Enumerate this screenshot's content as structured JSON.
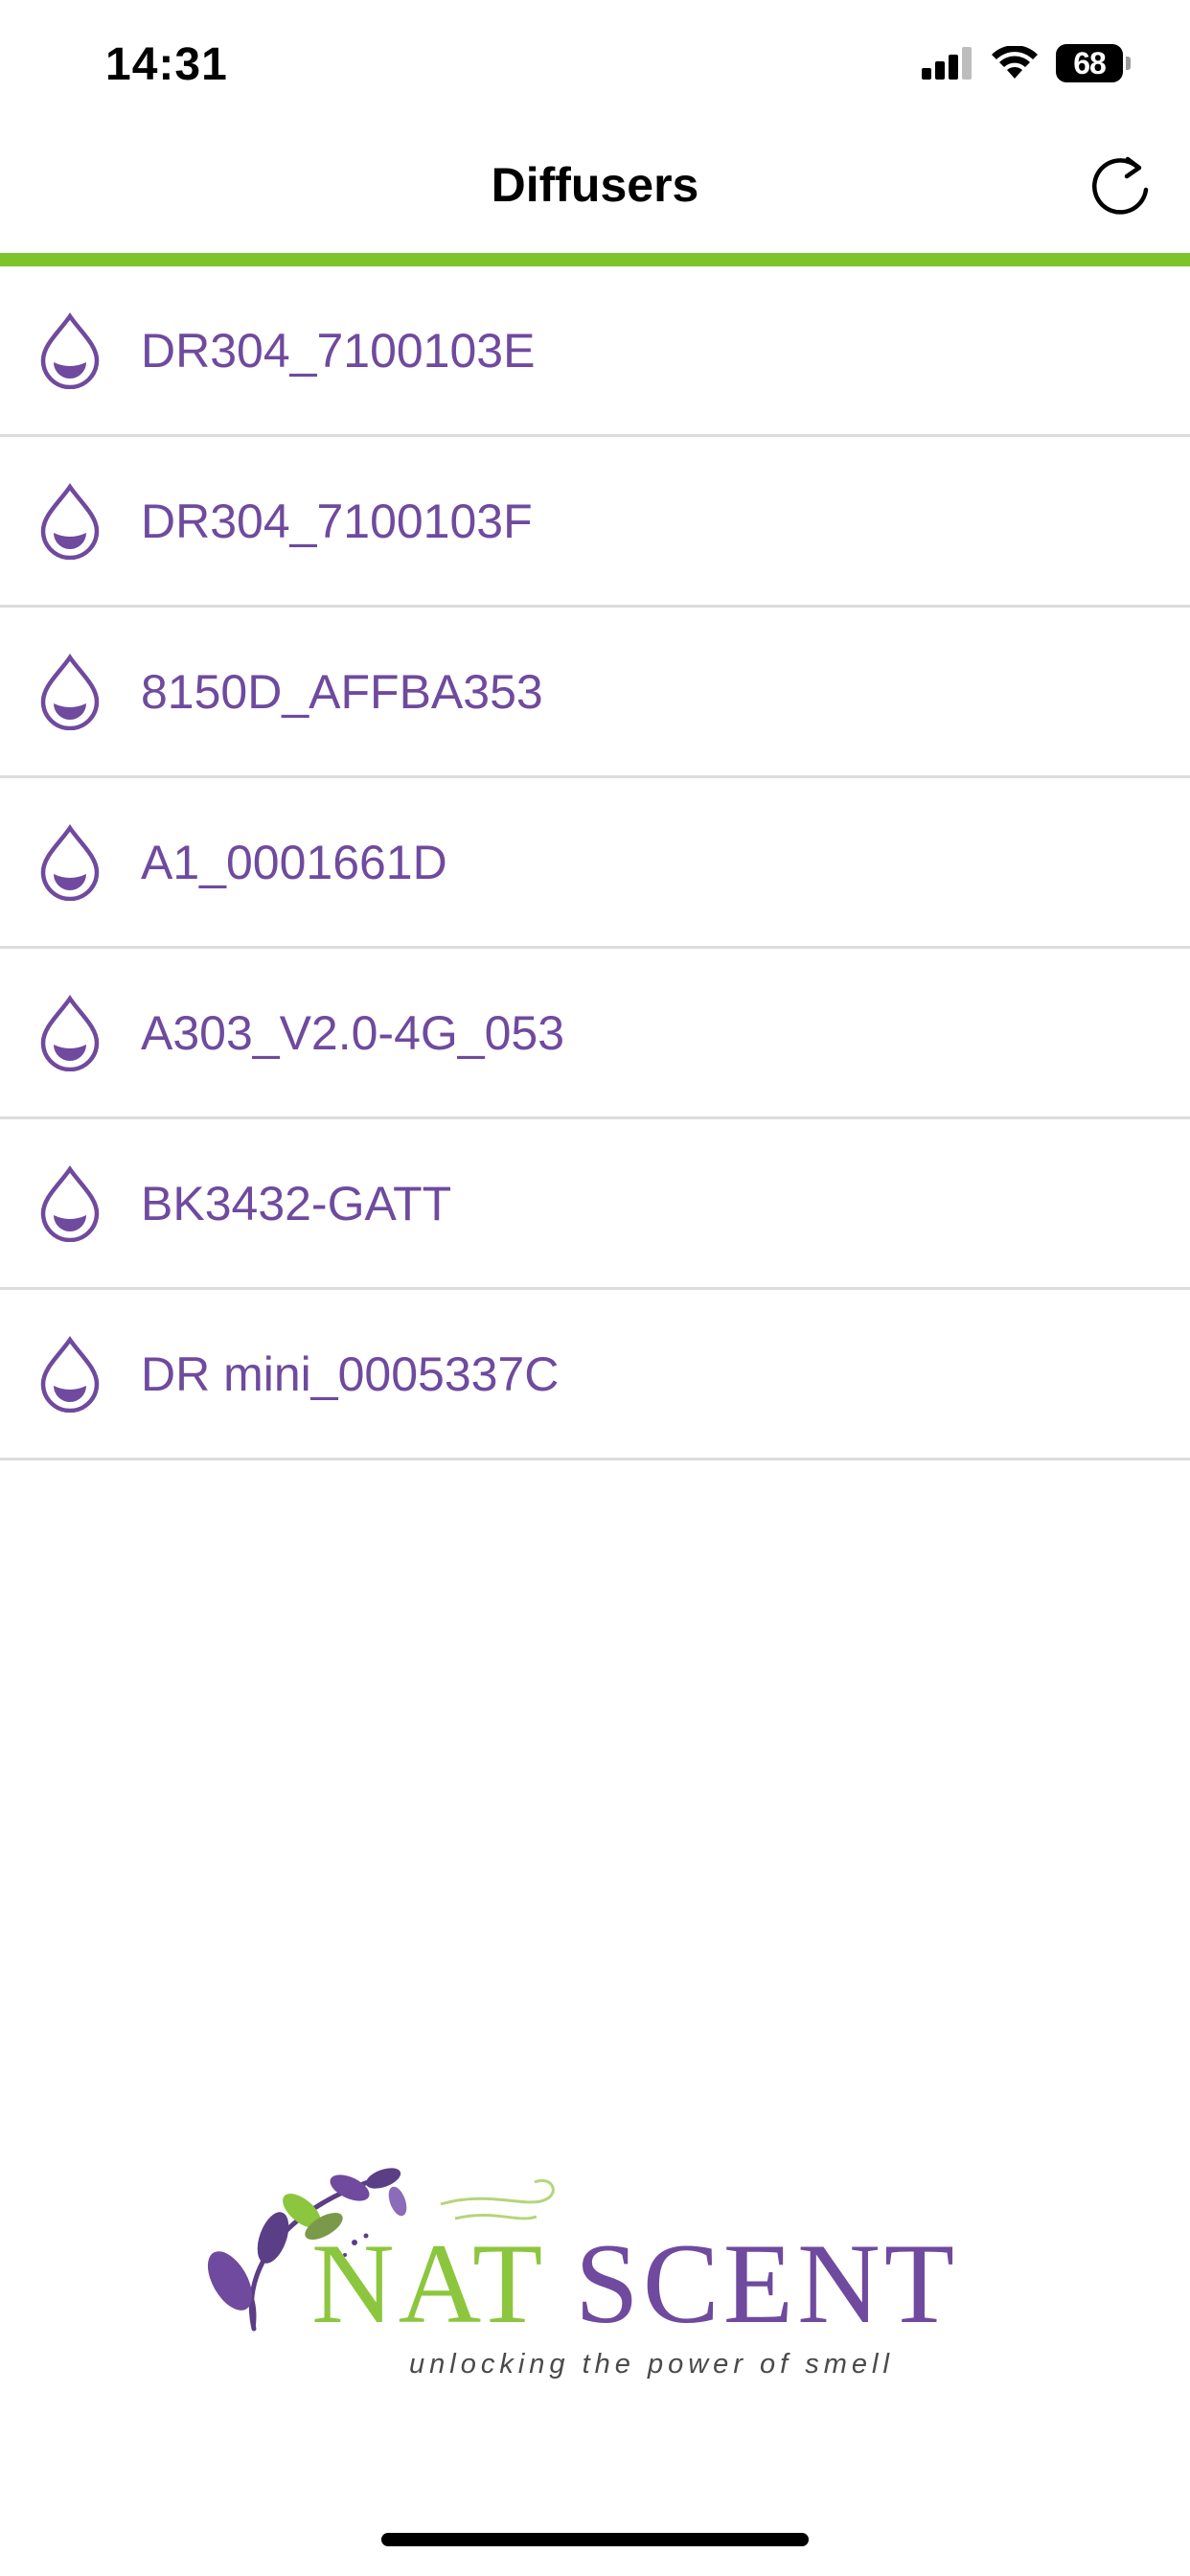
{
  "status_bar": {
    "time": "14:31",
    "battery_level": "68",
    "icons": [
      "signal-icon",
      "wifi-icon",
      "battery-icon"
    ]
  },
  "nav": {
    "title": "Diffusers",
    "refresh_icon": "refresh-icon"
  },
  "colors": {
    "accent_green": "#7dc42a",
    "device_purple": "#6f4a9e",
    "divider": "#dcdcdc"
  },
  "devices": [
    {
      "name": "DR304_7100103E",
      "icon": "droplet-icon"
    },
    {
      "name": "DR304_7100103F",
      "icon": "droplet-icon"
    },
    {
      "name": "8150D_AFFBA353",
      "icon": "droplet-icon"
    },
    {
      "name": "A1_0001661D",
      "icon": "droplet-icon"
    },
    {
      "name": "A303_V2.0-4G_053",
      "icon": "droplet-icon"
    },
    {
      "name": "BK3432-GATT",
      "icon": "droplet-icon"
    },
    {
      "name": "DR mini_0005337C",
      "icon": "droplet-icon"
    }
  ],
  "logo": {
    "brand_nat": "NAT",
    "brand_scent": "SCENT",
    "tagline": "unlocking the power of smell"
  }
}
